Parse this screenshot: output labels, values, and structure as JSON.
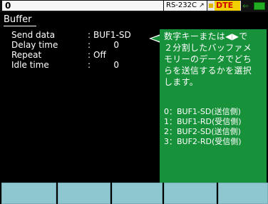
{
  "status_bar": {
    "channel": "0",
    "interface_badge": "RS-232C",
    "interface_icon": "connector-icon",
    "dte_label": "DTE",
    "dte_badge_color": "#f0d000",
    "status_icons": [
      "arrow-icon",
      "battery-icon"
    ]
  },
  "screen": {
    "title": "Buffer",
    "params": [
      {
        "label": "Send data",
        "value": "BUF1-SD"
      },
      {
        "label": "Delay time",
        "value": "0"
      },
      {
        "label": "Repeat",
        "value": "Off"
      },
      {
        "label": "Idle time",
        "value": "0"
      }
    ]
  },
  "help": {
    "lines": [
      "数字キーまたは◀▶で",
      "２分割したバッファメ",
      "モリーのデータでどち",
      "らを送信するかを選択",
      "します。"
    ],
    "options": [
      "0：BUF1-SD(送信側)",
      "1：BUF1-RD(受信側)",
      "2：BUF2-SD(送信側)",
      "3：BUF2-RD(受信側)"
    ],
    "background": "#17913a"
  },
  "function_keys": {
    "count": 5,
    "labels": [
      "",
      "",
      "",
      "",
      ""
    ]
  }
}
